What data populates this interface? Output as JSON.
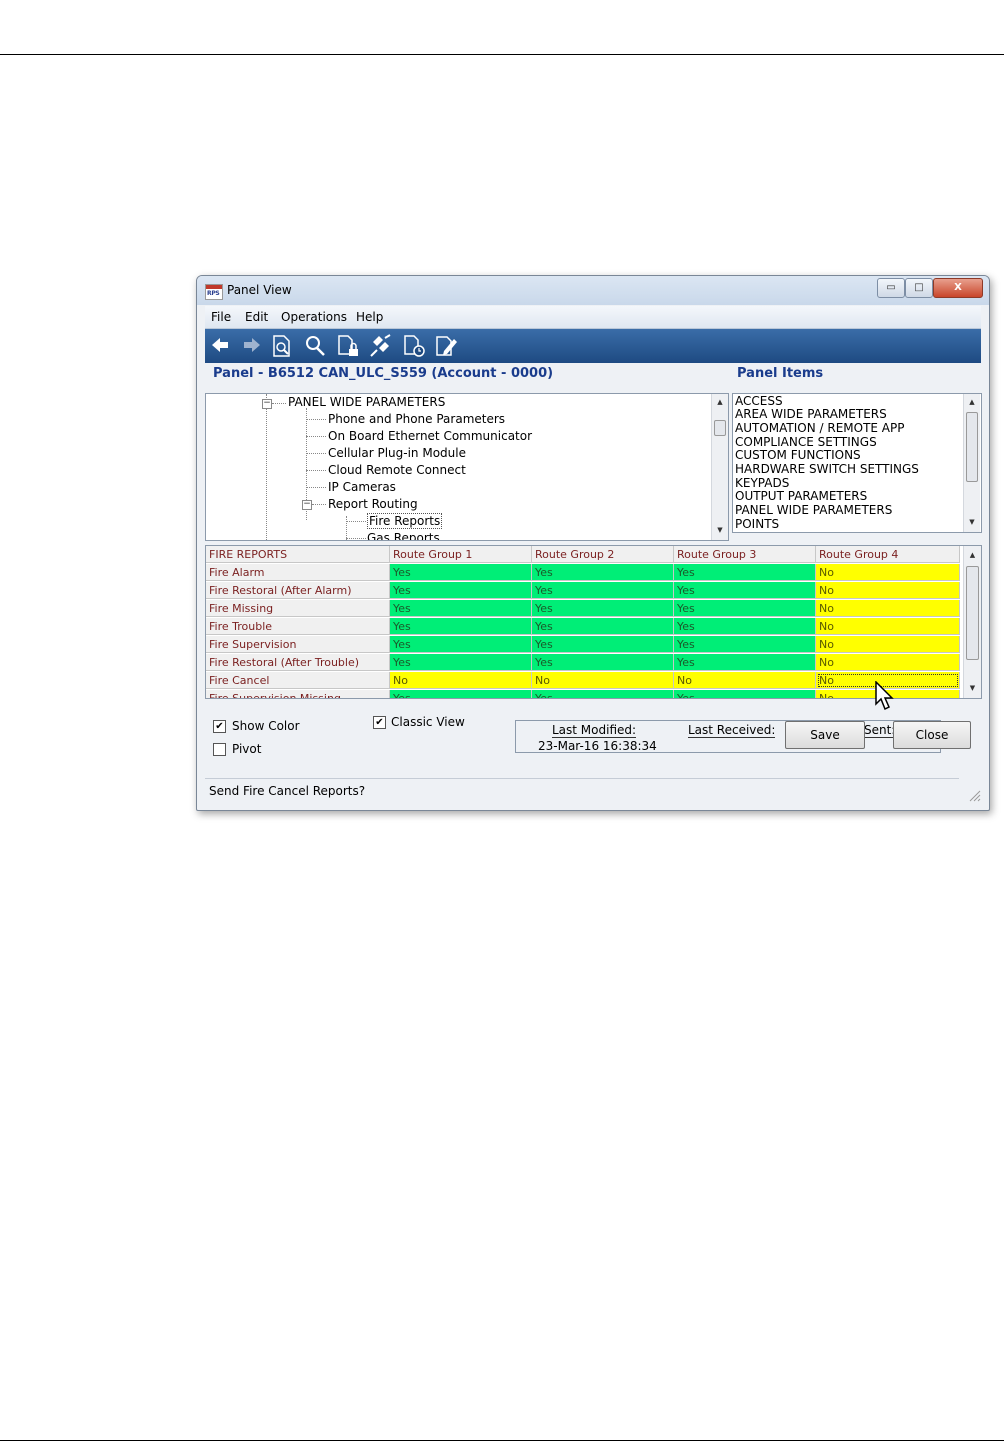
{
  "window": {
    "title": "Panel View",
    "app_icon_text": "RPS",
    "controls": {
      "minimize": "▭",
      "maximize": "□",
      "close": "X"
    }
  },
  "menu": [
    "File",
    "Edit",
    "Operations",
    "Help"
  ],
  "toolbar": {
    "icons": [
      "back-arrow-icon",
      "forward-arrow-icon",
      "document-search-icon",
      "magnify-icon",
      "document-lock-icon",
      "connect-plug-icon",
      "document-clock-icon",
      "document-edit-icon"
    ]
  },
  "panel_header": "Panel - B6512 CAN_ULC_S559 (Account - 0000)",
  "panel_items_header": "Panel Items",
  "tree": {
    "root": "PANEL WIDE PARAMETERS",
    "children": [
      "Phone and Phone Parameters",
      "On Board Ethernet Communicator",
      "Cellular Plug-in Module",
      "Cloud Remote Connect",
      "IP Cameras",
      "Report Routing"
    ],
    "report_routing_children": [
      "Fire Reports",
      "Gas Reports"
    ],
    "selected": "Fire Reports"
  },
  "panel_items": [
    "ACCESS",
    "AREA WIDE PARAMETERS",
    "AUTOMATION / REMOTE APP",
    "COMPLIANCE SETTINGS",
    "CUSTOM FUNCTIONS",
    "HARDWARE SWITCH SETTINGS",
    "KEYPADS",
    "OUTPUT PARAMETERS",
    "PANEL WIDE PARAMETERS",
    "POINTS"
  ],
  "grid": {
    "columns": [
      "FIRE REPORTS",
      "Route Group 1",
      "Route Group 2",
      "Route Group 3",
      "Route Group 4"
    ],
    "rows": [
      {
        "label": "Fire Alarm",
        "values": [
          "Yes",
          "Yes",
          "Yes",
          "No"
        ]
      },
      {
        "label": "Fire Restoral (After Alarm)",
        "values": [
          "Yes",
          "Yes",
          "Yes",
          "No"
        ]
      },
      {
        "label": "Fire Missing",
        "values": [
          "Yes",
          "Yes",
          "Yes",
          "No"
        ]
      },
      {
        "label": "Fire Trouble",
        "values": [
          "Yes",
          "Yes",
          "Yes",
          "No"
        ]
      },
      {
        "label": "Fire Supervision",
        "values": [
          "Yes",
          "Yes",
          "Yes",
          "No"
        ]
      },
      {
        "label": "Fire Restoral (After Trouble)",
        "values": [
          "Yes",
          "Yes",
          "Yes",
          "No"
        ]
      },
      {
        "label": "Fire Cancel",
        "values": [
          "No",
          "No",
          "No",
          "No"
        ]
      },
      {
        "label": "Fire Supervision Missing",
        "values": [
          "Yes",
          "Yes",
          "Yes",
          "No"
        ]
      }
    ],
    "colors": {
      "yes": "#00ee77",
      "no": "#ffff00"
    }
  },
  "options": {
    "show_color": {
      "label": "Show Color",
      "checked": true
    },
    "pivot": {
      "label": "Pivot",
      "checked": false
    },
    "classic_view": {
      "label": "Classic View",
      "checked": true
    }
  },
  "status": {
    "last_modified_label": "Last Modified:",
    "last_modified_value": "23-Mar-16 16:38:34",
    "last_received_label": "Last Received:",
    "sent_label": "Sent:"
  },
  "buttons": {
    "save": "Save",
    "close": "Close"
  },
  "statusbar_text": "Send Fire Cancel Reports?",
  "check_glyph": "✔"
}
